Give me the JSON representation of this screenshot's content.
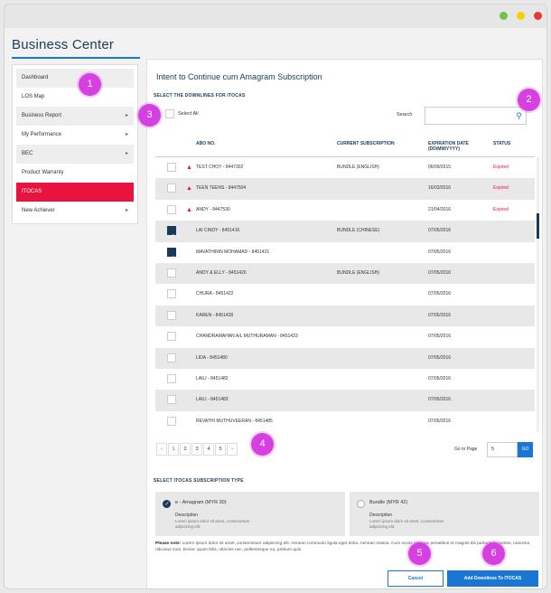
{
  "window": {
    "controls": [
      "green",
      "yellow",
      "red"
    ]
  },
  "brand": "Business Center",
  "sidebar": {
    "items": [
      {
        "label": "Dashboard",
        "caret": false,
        "active": false
      },
      {
        "label": "LOS Map",
        "caret": false,
        "active": false
      },
      {
        "label": "Business Report",
        "caret": true,
        "active": false
      },
      {
        "label": "My Performance",
        "caret": true,
        "active": false
      },
      {
        "label": "BEC",
        "caret": true,
        "active": false
      },
      {
        "label": "Product Warranty",
        "caret": false,
        "active": false
      },
      {
        "label": "ITOCAS",
        "caret": false,
        "active": true
      },
      {
        "label": "New Achiever",
        "caret": true,
        "active": false
      }
    ]
  },
  "main": {
    "title": "Intent to Continue cum Amagram Subscription",
    "downlines_label": "SELECT THE DOWNLINES FOR ITOCAS",
    "select_all": "Select All",
    "search_label": "Search",
    "search_value": "",
    "columns": {
      "abo": "ABO NO.",
      "subscription": "CURRENT SUBSCRIPTION",
      "expiration": "EXPIRATION DATE",
      "expiration_format": "(DD/MM/YYYY)",
      "status": "STATUS"
    },
    "rows": [
      {
        "checked": false,
        "warning": true,
        "abo": "TEST CHOY - 8447302",
        "subscription": "BUNDLE (ENGLISH)",
        "expiration": "06/09/2015",
        "status": "Expired"
      },
      {
        "checked": false,
        "warning": true,
        "abo": "TEEN TEENS - 8447504",
        "subscription": "",
        "expiration": "16/03/2016",
        "status": "Expired"
      },
      {
        "checked": false,
        "warning": true,
        "abo": "ANDY - 8447530",
        "subscription": "",
        "expiration": "21/04/2016",
        "status": "Expired"
      },
      {
        "checked": true,
        "warning": false,
        "abo": "LAI CINDY - 8451416",
        "subscription": "BUNDLE (CHINESE)",
        "expiration": "07/05/2016",
        "status": ""
      },
      {
        "checked": true,
        "warning": false,
        "abo": "MAVATHIRIN MOHAMAD - 8451421",
        "subscription": "",
        "expiration": "07/05/2016",
        "status": ""
      },
      {
        "checked": false,
        "warning": false,
        "abo": "ANDY & ELLY - 8451426",
        "subscription": "BUNDLE (ENGLISH)",
        "expiration": "07/05/2016",
        "status": ""
      },
      {
        "checked": false,
        "warning": false,
        "abo": "CHURA - 8451422",
        "subscription": "",
        "expiration": "07/05/2016",
        "status": ""
      },
      {
        "checked": false,
        "warning": false,
        "abo": "KAREN - 8451428",
        "subscription": "",
        "expiration": "07/05/2016",
        "status": ""
      },
      {
        "checked": false,
        "warning": false,
        "abo": "CHANDRAMAHAN A/L MUTHURAMAN - 8451433",
        "subscription": "",
        "expiration": "07/05/2016",
        "status": ""
      },
      {
        "checked": false,
        "warning": false,
        "abo": "LIDA - 8451480",
        "subscription": "",
        "expiration": "07/05/2016",
        "status": ""
      },
      {
        "checked": false,
        "warning": false,
        "abo": "LAILI - 8451482",
        "subscription": "",
        "expiration": "07/05/2016",
        "status": ""
      },
      {
        "checked": false,
        "warning": false,
        "abo": "LAILI - 8451483",
        "subscription": "",
        "expiration": "07/05/2016",
        "status": ""
      },
      {
        "checked": false,
        "warning": false,
        "abo": "REVATHI MUTHUVEERAN - 8451485",
        "subscription": "",
        "expiration": "07/05/2016",
        "status": ""
      }
    ],
    "pagination": {
      "prev": "‹",
      "pages": [
        "1",
        "2",
        "3",
        "4",
        "5"
      ],
      "current": "1",
      "next": "›"
    },
    "goto_label": "Go to Page",
    "goto_value": "5",
    "goto_button": "GO",
    "subscription_type_label": "SELECT ITOCAS SUBSCRIPTION TYPE",
    "options": [
      {
        "title": "e - Amagram (MYR 30)",
        "selected": true,
        "desc_title": "Description",
        "desc": "Lorem ipsum dolor sit amet, consectetuer adipiscing elit."
      },
      {
        "title": "Bundle (MYR 42)",
        "selected": false,
        "desc_title": "Description",
        "desc": "Lorem ipsum dolor sit amet, consectetuer adipiscing elit."
      }
    ],
    "note_label": "Please note:",
    "note_text": "Lorem ipsum dolor sit amet, consectetuer adipiscing elit. Aenean commodo ligula eget dolor. Aenean massa. Cum sociis natoque penatibus et magnis dis parturient montes, nascetur ridiculus mus. Donec quam felis, ultricies nec, pellentesque eu, pretium quis.",
    "cancel_label": "Cancel",
    "add_label": "Add Downlines To ITOCAS"
  },
  "markers": [
    "1",
    "2",
    "3",
    "4",
    "5",
    "6"
  ]
}
